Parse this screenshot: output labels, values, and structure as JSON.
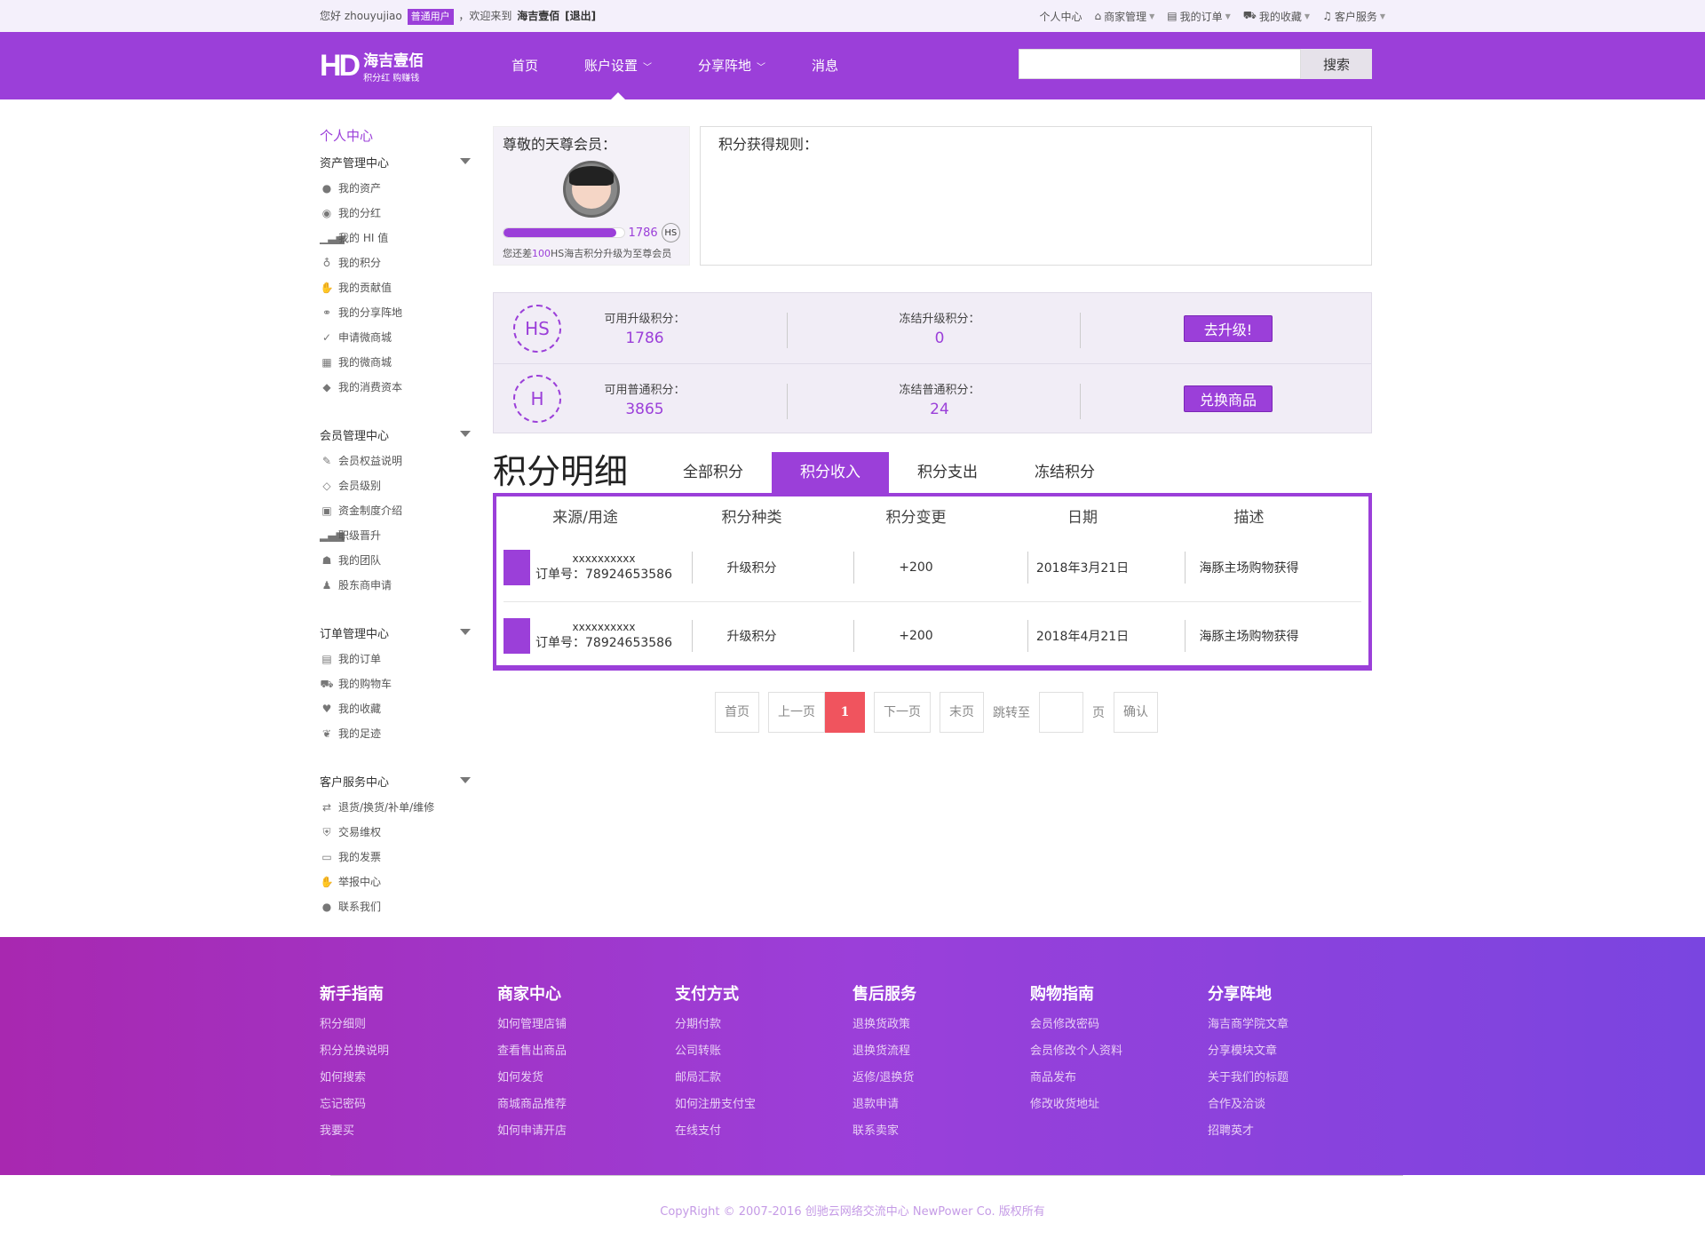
{
  "topbar": {
    "greeting": "您好 zhouyujiao",
    "user_badge": "普通用户",
    "welcome": "，欢迎来到",
    "site_name": "海吉壹佰",
    "logout": "[退出]",
    "links": [
      {
        "label": "个人中心",
        "icon": ""
      },
      {
        "label": "商家管理",
        "icon": "home-icon"
      },
      {
        "label": "我的订单",
        "icon": "list-icon"
      },
      {
        "label": "我的收藏",
        "icon": "cart-icon"
      },
      {
        "label": "客户服务",
        "icon": "bell-icon"
      }
    ]
  },
  "header": {
    "logo_mark": "HD",
    "logo_title": "海吉壹佰",
    "logo_sub": "积分红 购赚钱",
    "nav": [
      "首页",
      "账户设置",
      "分享阵地",
      "消息"
    ],
    "search_placeholder": "",
    "search_button": "搜索"
  },
  "sidebar": {
    "title": "个人中心",
    "groups": [
      {
        "title": "资产管理中心",
        "items": [
          "我的资产",
          "我的分红",
          "我的 HI 值",
          "我的积分",
          "我的贡献值",
          "我的分享阵地",
          "申请微商城",
          "我的微商城",
          "我的消费资本"
        ]
      },
      {
        "title": "会员管理中心",
        "items": [
          "会员权益说明",
          "会员级别",
          "资金制度介绍",
          "职级晋升",
          "我的团队",
          "股东商申请"
        ]
      },
      {
        "title": "订单管理中心",
        "items": [
          "我的订单",
          "我的购物车",
          "我的收藏",
          "我的足迹"
        ]
      },
      {
        "title": "客户服务中心",
        "items": [
          "退货/换货/补单/维修",
          "交易维权",
          "我的发票",
          "举报中心",
          "联系我们"
        ]
      }
    ]
  },
  "member": {
    "title": "尊敬的天尊会员：",
    "progress_value": "1786",
    "progress_fraction": 0.94,
    "badge": "HS",
    "hint_pre": "您还差",
    "hint_em": "100",
    "hint_post": "HS海吉积分升级为至尊会员"
  },
  "rules": {
    "title": "积分获得规则："
  },
  "points": [
    {
      "seal": "HS",
      "label1": "可用升级积分：",
      "val1": "1786",
      "label2": "冻结升级积分：",
      "val2": "0",
      "button": "去升级!"
    },
    {
      "seal": "H",
      "label1": "可用普通积分：",
      "val1": "3865",
      "label2": "冻结普通积分：",
      "val2": "24",
      "button": "兑换商品"
    }
  ],
  "detail": {
    "title": "积分明细",
    "tabs": [
      "全部积分",
      "积分收入",
      "积分支出",
      "冻结积分"
    ],
    "columns": [
      "来源/用途",
      "积分种类",
      "积分变更",
      "日期",
      "描述"
    ],
    "rows": [
      {
        "name": "xxxxxxxxxx",
        "order": "订单号：78924653586",
        "type": "升级积分",
        "change": "+200",
        "date": "2018年3月21日",
        "desc": "海豚主场购物获得"
      },
      {
        "name": "xxxxxxxxxx",
        "order": "订单号：78924653586",
        "type": "升级积分",
        "change": "+200",
        "date": "2018年4月21日",
        "desc": "海豚主场购物获得"
      }
    ]
  },
  "pager": {
    "first": "首页",
    "prev": "上一页",
    "current": "1",
    "next": "下一页",
    "last": "末页",
    "jump": "跳转至",
    "page": "页",
    "confirm": "确认"
  },
  "footer": {
    "columns": [
      {
        "title": "新手指南",
        "links": [
          "积分细则",
          "积分兑换说明",
          "如何搜索",
          "忘记密码",
          "我要买"
        ]
      },
      {
        "title": "商家中心",
        "links": [
          "如何管理店铺",
          "查看售出商品",
          "如何发货",
          "商城商品推荐",
          "如何申请开店"
        ]
      },
      {
        "title": "支付方式",
        "links": [
          "分期付款",
          "公司转账",
          "邮局汇款",
          "如何注册支付宝",
          "在线支付"
        ]
      },
      {
        "title": "售后服务",
        "links": [
          "退换货政策",
          "退换货流程",
          "返修/退换货",
          "退款申请",
          "联系卖家"
        ]
      },
      {
        "title": "购物指南",
        "links": [
          "会员修改密码",
          "会员修改个人资料",
          "商品发布",
          "修改收货地址"
        ]
      },
      {
        "title": "分享阵地",
        "links": [
          "海吉商学院文章",
          "分享模块文章",
          "关于我们的标题",
          "合作及洽谈",
          "招聘英才"
        ]
      }
    ],
    "copyright": "CopyRight © 2007-2016 创驰云网络交流中心 NewPower Co. 版权所有"
  },
  "colors": {
    "accent": "#9b3fd9",
    "current_page": "#f0545e"
  }
}
